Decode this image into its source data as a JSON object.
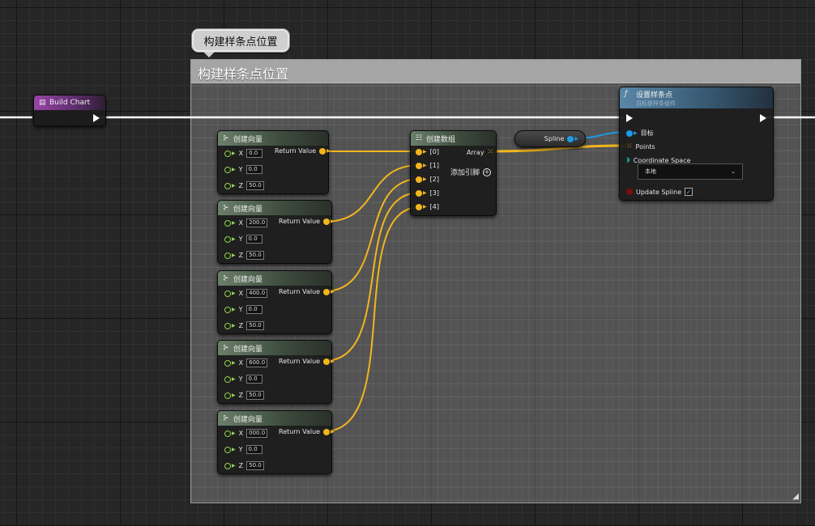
{
  "comment": {
    "bubble_text": "构建样条点位置",
    "header_text": "构建样条点位置"
  },
  "build_chart_node": {
    "title": "Build Chart"
  },
  "make_vector_nodes": [
    {
      "title": "创建向量",
      "x_label": "X",
      "x": "0.0",
      "y_label": "Y",
      "y": "0.0",
      "z_label": "Z",
      "z": "50.0",
      "return_label": "Return Value"
    },
    {
      "title": "创建向量",
      "x_label": "X",
      "x": "200.0",
      "y_label": "Y",
      "y": "0.0",
      "z_label": "Z",
      "z": "50.0",
      "return_label": "Return Value"
    },
    {
      "title": "创建向量",
      "x_label": "X",
      "x": "400.0",
      "y_label": "Y",
      "y": "0.0",
      "z_label": "Z",
      "z": "50.0",
      "return_label": "Return Value"
    },
    {
      "title": "创建向量",
      "x_label": "X",
      "x": "600.0",
      "y_label": "Y",
      "y": "0.0",
      "z_label": "Z",
      "z": "50.0",
      "return_label": "Return Value"
    },
    {
      "title": "创建向量",
      "x_label": "X",
      "x": "000.0",
      "y_label": "Y",
      "y": "0.0",
      "z_label": "Z",
      "z": "50.0",
      "return_label": "Return Value"
    }
  ],
  "make_array_node": {
    "title": "创建数组",
    "inputs": [
      "[0]",
      "[1]",
      "[2]",
      "[3]",
      "[4]"
    ],
    "output_label": "Array",
    "add_pin_label": "添加引脚"
  },
  "spline_var": {
    "label": "Spline"
  },
  "set_spline_points_node": {
    "title": "设置样条点",
    "subtitle": "目标是样条组件",
    "target_label": "目标",
    "points_label": "Points",
    "coord_space_label": "Coordinate Space",
    "coord_space_value": "本地",
    "update_spline_label": "Update Spline",
    "update_spline_checked": true
  },
  "icons": {
    "function": "function-icon",
    "make_vector": "make-vector-icon",
    "make_array": "make-array-icon",
    "event": "event-icon"
  },
  "colors": {
    "vector_pin": "#8fd34a",
    "array_wire": "#f2b51e",
    "object_pin": "#1e9be6",
    "exec_wire": "#ffffff"
  }
}
